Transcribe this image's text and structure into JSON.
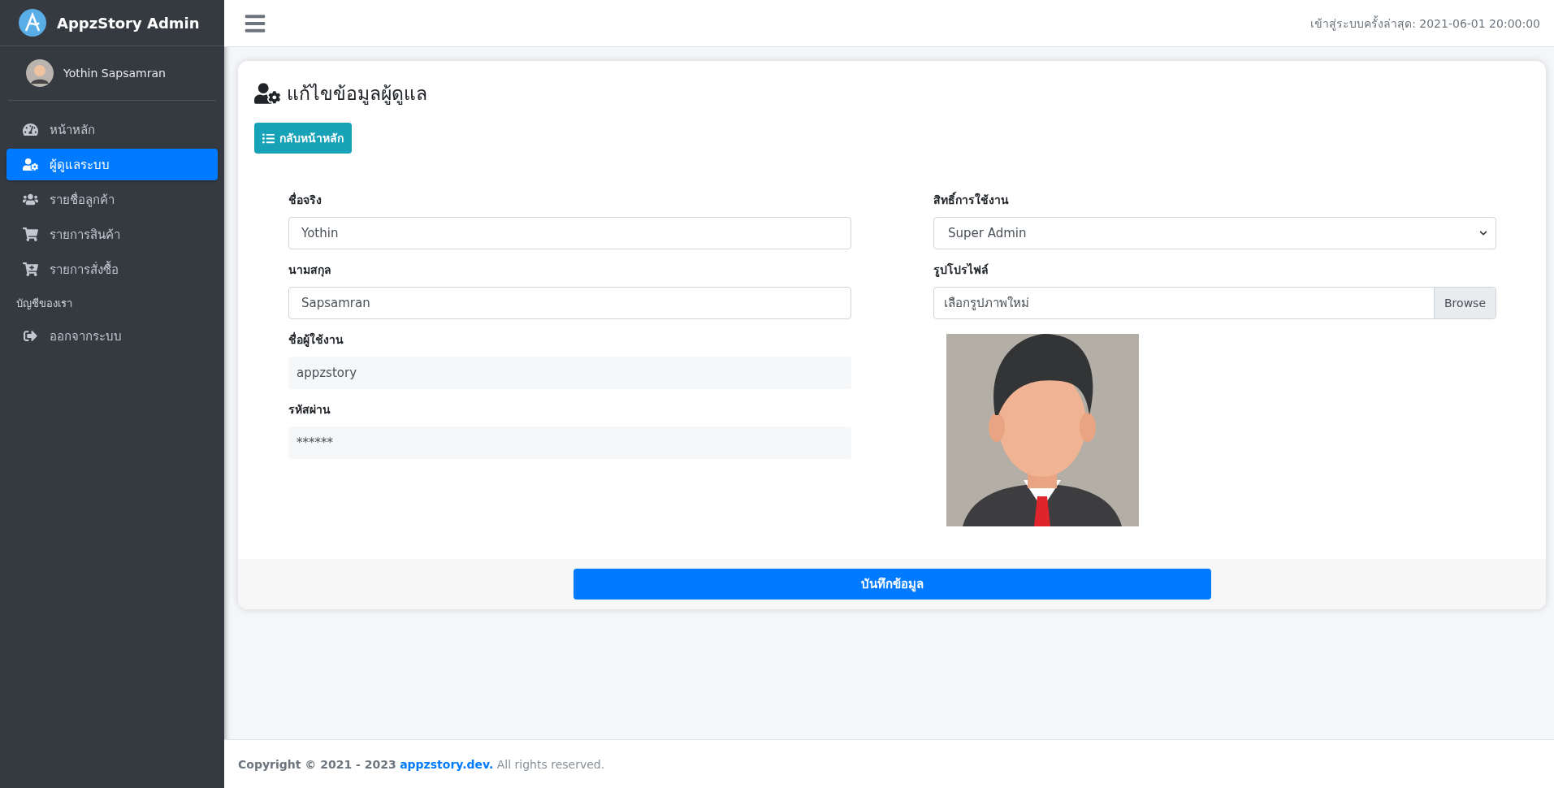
{
  "sidebar": {
    "brand": "AppzStory Admin",
    "user": "Yothin Sapsamran",
    "items": [
      {
        "kind": "link",
        "label": "หน้าหลัก",
        "selected": false
      },
      {
        "kind": "link",
        "label": "ผู้ดูแลระบบ",
        "selected": true
      },
      {
        "kind": "link",
        "label": "รายชื่อลูกค้า",
        "selected": false
      },
      {
        "kind": "link",
        "label": "รายการสินค้า",
        "selected": false
      },
      {
        "kind": "link",
        "label": "รายการสั่งซื้อ",
        "selected": false
      },
      {
        "kind": "header",
        "label": "บัญชีของเรา"
      },
      {
        "kind": "link",
        "label": "ออกจากระบบ",
        "selected": false
      }
    ]
  },
  "header": {
    "last_login": "เข้าสู่ระบบครั้งล่าสุด: 2021-06-01 20:00:00"
  },
  "card": {
    "title": "แก้ไขข้อมูลผู้ดูแล",
    "back_button": "กลับหน้าหลัก",
    "left_fields": [
      {
        "kind": "input",
        "label": "ชื่อจริง",
        "value": "Yothin",
        "disabled": false
      },
      {
        "kind": "input",
        "label": "นามสกุล",
        "value": "Sapsamran",
        "disabled": false
      },
      {
        "kind": "input",
        "label": "ชื่อผู้ใช้งาน",
        "value": "appzstory",
        "disabled": true
      },
      {
        "kind": "input",
        "label": "รหัสผ่าน",
        "value": "******",
        "disabled": true
      }
    ],
    "right_fields": [
      {
        "kind": "select",
        "label": "สิทธิ์การใช้งาน",
        "value": "Super Admin"
      },
      {
        "kind": "file",
        "label": "รูปโปรไฟล์",
        "placeholder": "เลือกรูปภาพใหม่",
        "button": "Browse"
      }
    ],
    "save_button": "บันทึกข้อมูล"
  },
  "footer": {
    "copyright": "Copyright © 2021 - 2023",
    "link": "appzstory.dev.",
    "rights": "All rights reserved."
  }
}
